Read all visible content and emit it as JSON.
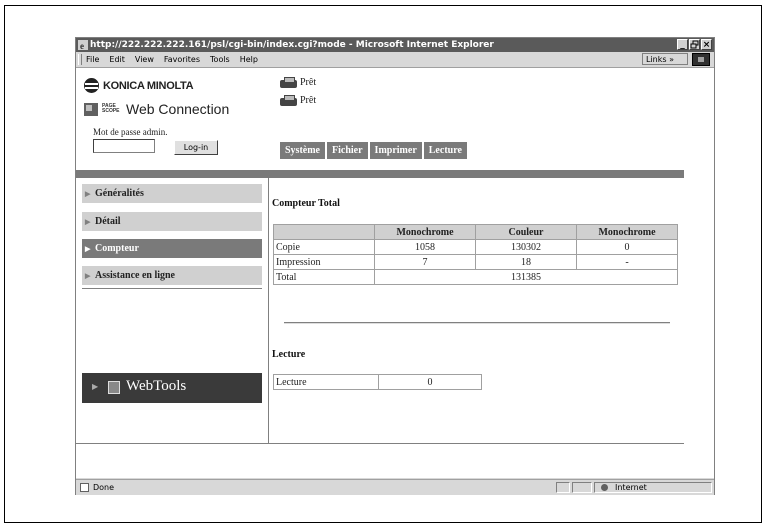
{
  "window": {
    "title": "http://222.222.222.161/psl/cgi-bin/index.cgi?mode - Microsoft Internet Explorer",
    "controls": [
      "_",
      "×"
    ],
    "maximize_icon": "restore-icon"
  },
  "menubar": {
    "items": [
      "File",
      "Edit",
      "View",
      "Favorites",
      "Tools",
      "Help"
    ],
    "links_label": "Links »"
  },
  "header": {
    "brand": "KONICA MINOLTA",
    "pagescope_small": "PAGE SCOPE",
    "pagescope": "Web Connection",
    "admin_label": "Mot de passe admin.",
    "admin_input_value": "",
    "login_button": "Log-in",
    "printer_status": [
      "Prêt",
      "Prêt"
    ]
  },
  "tabs": [
    "Système",
    "Fichier",
    "Imprimer",
    "Lecture"
  ],
  "leftnav": {
    "items": [
      {
        "label": "Généralités",
        "active": false
      },
      {
        "label": "Détail",
        "active": false
      },
      {
        "label": "Compteur",
        "active": true
      },
      {
        "label": "Assistance en ligne",
        "active": false
      }
    ],
    "webtools": "WebTools"
  },
  "main": {
    "counter_title": "Compteur Total",
    "counter_table": {
      "headers": [
        "",
        "Monochrome",
        "Couleur",
        "Monochrome"
      ],
      "rows": [
        {
          "label": "Copie",
          "values": [
            "1058",
            "130302",
            "0"
          ]
        },
        {
          "label": "Impression",
          "values": [
            "7",
            "18",
            "-"
          ]
        }
      ],
      "total_label": "Total",
      "total_value": "131385"
    },
    "lecture_title": "Lecture",
    "lecture_table": {
      "label": "Lecture",
      "value": "0"
    }
  },
  "statusbar": {
    "status": "Done",
    "zone": "Internet"
  },
  "colors": {
    "tab_bg": "#7a7a7a",
    "nav_bg": "#d0d0d0",
    "nav_active_bg": "#7a7a7a",
    "webtools_bg": "#3a3a3a"
  }
}
